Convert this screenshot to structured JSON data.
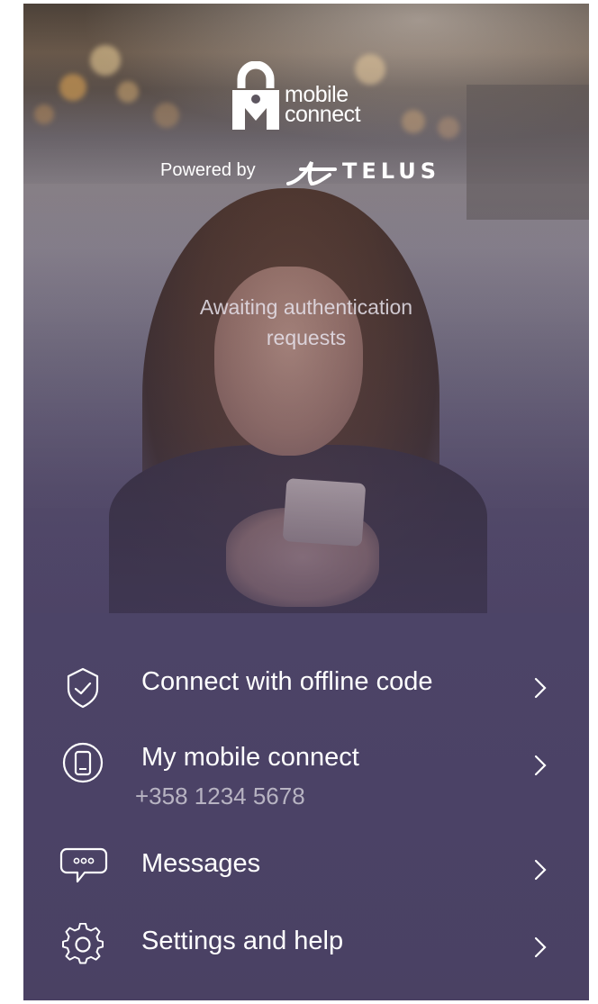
{
  "brand": {
    "logo_line1": "mobile",
    "logo_line2": "connect",
    "powered_by": "Powered by",
    "partner": "TELUS"
  },
  "status": {
    "message": "Awaiting authentication requests"
  },
  "menu": {
    "items": [
      {
        "label": "Connect with offline code",
        "icon": "shield-check-icon"
      },
      {
        "label": "My mobile connect",
        "sub": "+358 1234 5678",
        "icon": "phone-icon"
      },
      {
        "label": "Messages",
        "icon": "chat-bubble-icon"
      },
      {
        "label": "Settings and help",
        "icon": "gear-icon"
      }
    ]
  },
  "colors": {
    "menu_background": "#4a4163",
    "text": "#ffffff"
  }
}
